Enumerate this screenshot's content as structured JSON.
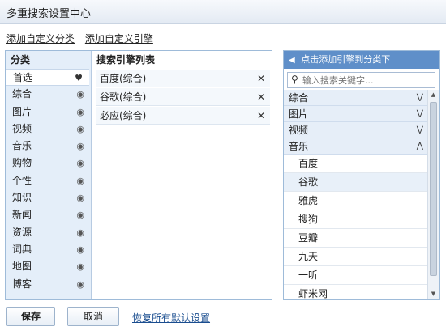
{
  "window": {
    "title": "多重搜索设置中心"
  },
  "toplinks": {
    "add_category": "添加自定义分类",
    "add_engine": "添加自定义引擎"
  },
  "left": {
    "category_header": "分类",
    "engine_header": "搜索引擎列表",
    "categories": [
      {
        "label": "首选",
        "icon": "heart-icon"
      },
      {
        "label": "综合",
        "icon": "eye-icon"
      },
      {
        "label": "图片",
        "icon": "eye-icon"
      },
      {
        "label": "视频",
        "icon": "eye-icon"
      },
      {
        "label": "音乐",
        "icon": "eye-icon"
      },
      {
        "label": "购物",
        "icon": "eye-icon"
      },
      {
        "label": "个性",
        "icon": "eye-icon"
      },
      {
        "label": "知识",
        "icon": "eye-icon"
      },
      {
        "label": "新闻",
        "icon": "eye-icon"
      },
      {
        "label": "资源",
        "icon": "eye-icon"
      },
      {
        "label": "词典",
        "icon": "eye-icon"
      },
      {
        "label": "地图",
        "icon": "eye-icon"
      },
      {
        "label": "博客",
        "icon": "eye-icon"
      }
    ],
    "engines": [
      "百度(综合)",
      "谷歌(综合)",
      "必应(综合)"
    ]
  },
  "right": {
    "header": "点击添加引擎到分类下",
    "search_placeholder": "输入搜索关键字...",
    "groups": [
      {
        "label": "综合",
        "chevron": "»"
      },
      {
        "label": "图片",
        "chevron": "»"
      },
      {
        "label": "视频",
        "chevron": "»"
      },
      {
        "label": "音乐",
        "chevron": "«"
      }
    ],
    "music_items": [
      "百度",
      "谷歌",
      "雅虎",
      "搜狗",
      "豆瓣",
      "九天",
      "一听",
      "虾米网"
    ]
  },
  "buttons": {
    "save": "保存",
    "cancel": "取消",
    "restore": "恢复所有默认设置"
  }
}
